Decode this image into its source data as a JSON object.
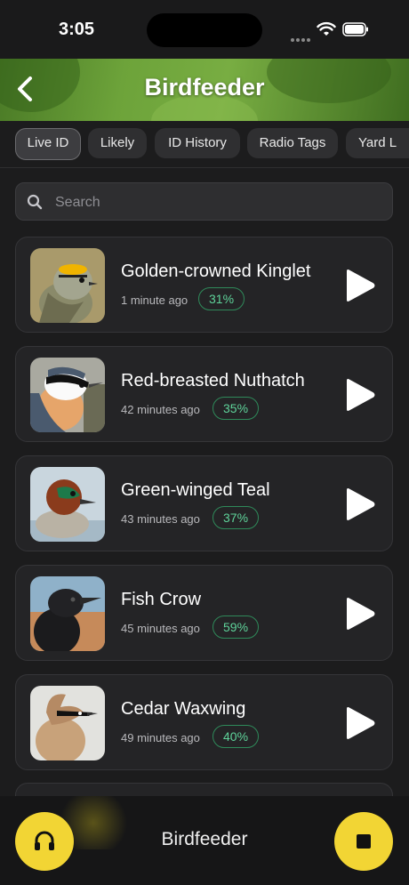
{
  "status_bar": {
    "time": "3:05"
  },
  "header": {
    "title": "Birdfeeder",
    "back_icon": "chevron-left-icon"
  },
  "tabs": [
    {
      "label": "Live ID",
      "active": true
    },
    {
      "label": "Likely",
      "active": false
    },
    {
      "label": "ID History",
      "active": false
    },
    {
      "label": "Radio Tags",
      "active": false
    },
    {
      "label": "Yard L",
      "active": false
    }
  ],
  "search": {
    "placeholder": "Search",
    "value": "",
    "icon": "search-icon"
  },
  "detections": [
    {
      "name": "Golden-crowned Kinglet",
      "time": "1 minute ago",
      "confidence": "31%"
    },
    {
      "name": "Red-breasted Nuthatch",
      "time": "42 minutes ago",
      "confidence": "35%"
    },
    {
      "name": "Green-winged Teal",
      "time": "43 minutes ago",
      "confidence": "37%"
    },
    {
      "name": "Fish Crow",
      "time": "45 minutes ago",
      "confidence": "59%"
    },
    {
      "name": "Cedar Waxwing",
      "time": "49 minutes ago",
      "confidence": "40%"
    }
  ],
  "player": {
    "title": "Birdfeeder",
    "listen_icon": "headphones-icon",
    "stop_icon": "stop-icon"
  },
  "colors": {
    "accent": "#f2d534",
    "badge_text": "#5fd39a",
    "badge_border": "#2f8a5a",
    "card_bg": "#242426",
    "page_bg": "#1c1c1d"
  }
}
